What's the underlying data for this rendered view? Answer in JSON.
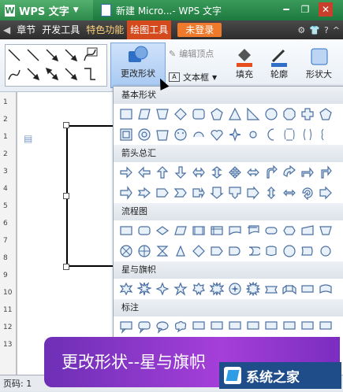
{
  "titlebar": {
    "app_name": "WPS 文字",
    "doc_title": "新建 Micro...- WPS 文字"
  },
  "menubar": {
    "items": [
      "章节",
      "开发工具",
      "特色功能",
      "绘图工具"
    ],
    "active": "绘图工具",
    "login": "未登录"
  },
  "ribbon": {
    "change_shape": "更改形状",
    "edit_points": "编辑顶点",
    "textbox": "文本框",
    "fill": "填充",
    "outline": "轮廓",
    "shape_style": "形状大"
  },
  "dropdown": {
    "sections": [
      {
        "title": "基本形状"
      },
      {
        "title": "箭头总汇"
      },
      {
        "title": "流程图"
      },
      {
        "title": "星与旗帜"
      },
      {
        "title": "标注"
      }
    ]
  },
  "ruler": {
    "numbers": [
      "1",
      "2",
      "1",
      "2",
      "3",
      "4",
      "5",
      "6",
      "7",
      "8",
      "9",
      "10",
      "11",
      "12",
      "13"
    ]
  },
  "statusbar": {
    "page": "页码: 1"
  },
  "caption": "更改形状--星与旗帜",
  "watermark": {
    "text": "系统之家"
  }
}
